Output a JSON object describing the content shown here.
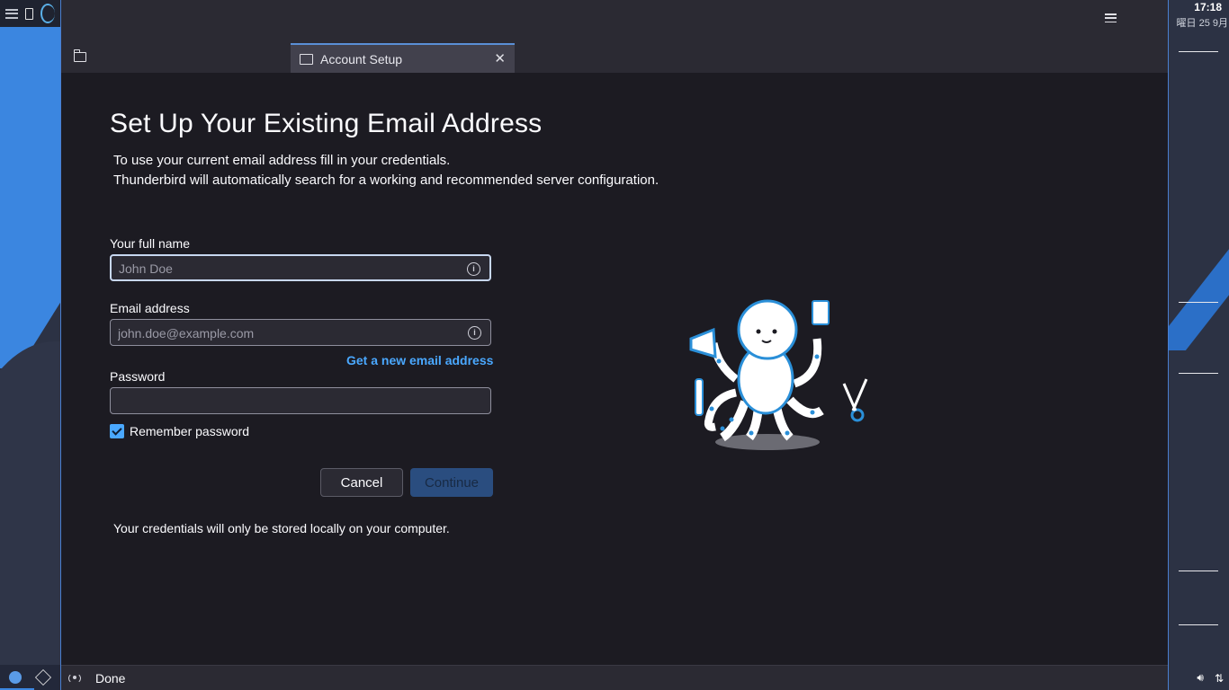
{
  "system": {
    "clock": "17:18",
    "date": "曜日 25 9月"
  },
  "tab": {
    "label": "Account Setup",
    "close": "✕"
  },
  "setup": {
    "title": "Set Up Your Existing Email Address",
    "subtitle_line1": "To use your current email address fill in your credentials.",
    "subtitle_line2": "Thunderbird will automatically search for a working and recommended server configuration.",
    "name_label": "Your full name",
    "name_placeholder": "John Doe",
    "email_label": "Email address",
    "email_placeholder": "john.doe@example.com",
    "get_email_link": "Get a new email address",
    "password_label": "Password",
    "remember_label": "Remember password",
    "cancel_label": "Cancel",
    "continue_label": "Continue",
    "note": "Your credentials will only be stored locally on your computer."
  },
  "status": {
    "text": "Done"
  },
  "colors": {
    "accent": "#4aa8ff",
    "window_bg": "#1c1b22",
    "toolbar_bg": "#2b2a33"
  }
}
